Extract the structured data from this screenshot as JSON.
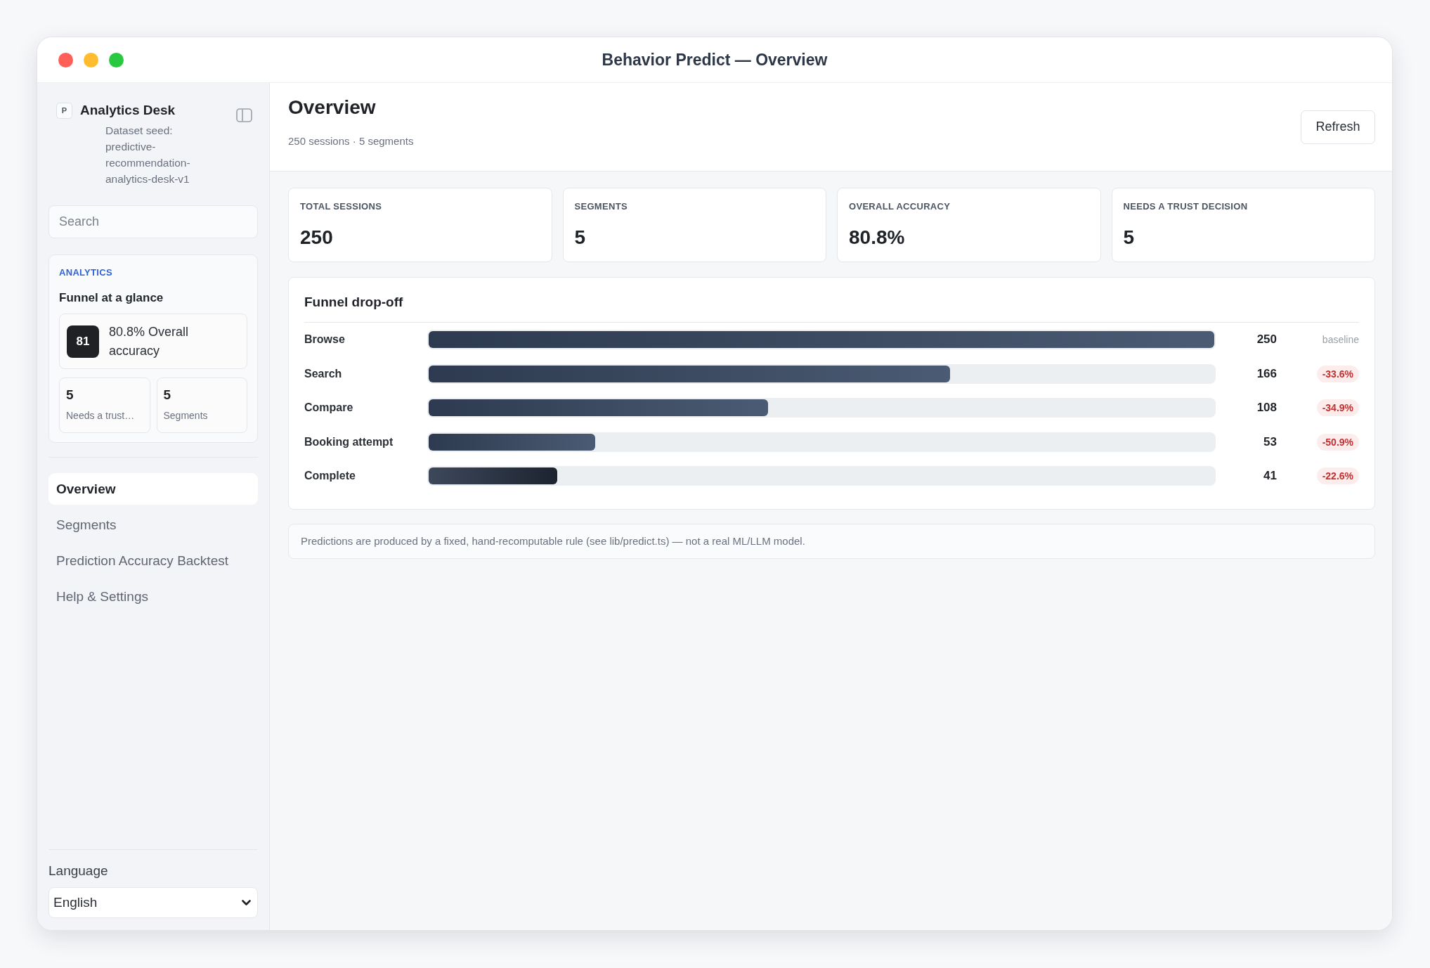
{
  "window": {
    "title": "Behavior Predict — Overview"
  },
  "sidebar": {
    "brand": {
      "logo": "P",
      "name": "Analytics Desk",
      "subtitle": "Dataset seed: predictive-recommendation-analytics-desk-v1"
    },
    "search": {
      "placeholder": "Search"
    },
    "summary_card": {
      "eyebrow": "ANALYTICS",
      "title": "Funnel at a glance",
      "score": "81",
      "score_text": "80.8% Overall accuracy",
      "mini_stats": [
        {
          "value": "5",
          "label": "Needs a trust…"
        },
        {
          "value": "5",
          "label": "Segments"
        }
      ]
    },
    "nav": [
      {
        "label": "Overview",
        "selected": true
      },
      {
        "label": "Segments",
        "selected": false
      },
      {
        "label": "Prediction Accuracy Backtest",
        "selected": false
      },
      {
        "label": "Help & Settings",
        "selected": false
      }
    ],
    "language": {
      "label": "Language",
      "value": "English"
    }
  },
  "header": {
    "title": "Overview",
    "subtitle": "250 sessions · 5 segments",
    "refresh_button": "Refresh"
  },
  "stats": [
    {
      "label": "TOTAL SESSIONS",
      "value": "250"
    },
    {
      "label": "SEGMENTS",
      "value": "5"
    },
    {
      "label": "OVERALL ACCURACY",
      "value": "80.8%"
    },
    {
      "label": "NEEDS A TRUST DECISION",
      "value": "5"
    }
  ],
  "funnel": {
    "title": "Funnel drop-off",
    "steps": [
      {
        "name": "Browse",
        "kind": "step",
        "level": 1,
        "count": "250",
        "change": {
          "kind": "baseline",
          "text": "baseline"
        }
      },
      {
        "name": "Search",
        "kind": "step",
        "level": 0.664,
        "count": "166",
        "change": {
          "kind": "drop",
          "text": "-33.6%"
        }
      },
      {
        "name": "Compare",
        "kind": "step",
        "level": 0.432,
        "count": "108",
        "change": {
          "kind": "drop",
          "text": "-34.9%"
        }
      },
      {
        "name": "Booking attempt",
        "kind": "step",
        "level": 0.212,
        "count": "53",
        "change": {
          "kind": "drop",
          "text": "-50.9%"
        }
      },
      {
        "name": "Complete",
        "kind": "goal",
        "level": 0.164,
        "count": "41",
        "change": {
          "kind": "drop",
          "text": "-22.6%"
        }
      }
    ]
  },
  "note": "Predictions are produced by a fixed, hand-recomputable rule (see lib/predict.ts) — not a real ML/LLM model."
}
